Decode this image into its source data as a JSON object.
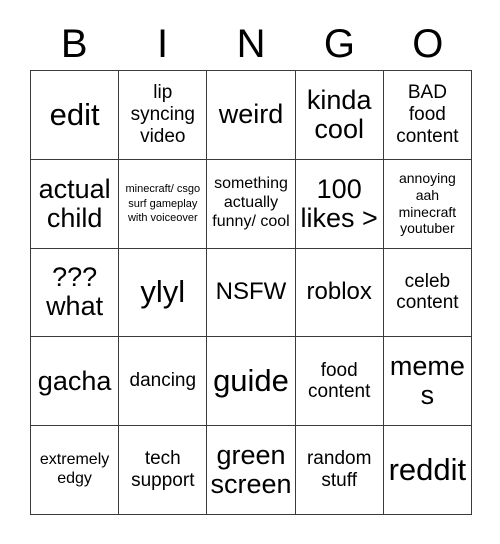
{
  "card": {
    "title": "BINGO",
    "header_letters": [
      "B",
      "I",
      "N",
      "G",
      "O"
    ],
    "columns": 5,
    "rows": 5,
    "border_color": "#3a3a3a",
    "background_color": "#ffffff",
    "text_color": "#000000",
    "cells": [
      {
        "text": "edit",
        "size": "xxl"
      },
      {
        "text": "lip syncing video",
        "size": "md"
      },
      {
        "text": "weird",
        "size": "xl"
      },
      {
        "text": "kinda cool",
        "size": "xl"
      },
      {
        "text": "BAD food content",
        "size": "md"
      },
      {
        "text": "actual child",
        "size": "xl"
      },
      {
        "text": "minecraft/ csgo surf gameplay with voiceover",
        "size": "xxs"
      },
      {
        "text": "something actually funny/ cool",
        "size": "sm"
      },
      {
        "text": "100 likes >",
        "size": "xl"
      },
      {
        "text": "annoying aah minecraft youtuber",
        "size": "xs"
      },
      {
        "text": "??? what",
        "size": "xl"
      },
      {
        "text": "ylyl",
        "size": "xxl"
      },
      {
        "text": "NSFW",
        "size": "lg"
      },
      {
        "text": "roblox",
        "size": "lg"
      },
      {
        "text": "celeb content",
        "size": "md"
      },
      {
        "text": "gacha",
        "size": "xl"
      },
      {
        "text": "dancing",
        "size": "md"
      },
      {
        "text": "guide",
        "size": "xxl"
      },
      {
        "text": "food content",
        "size": "md"
      },
      {
        "text": "memes",
        "size": "xl"
      },
      {
        "text": "extremely edgy",
        "size": "sm"
      },
      {
        "text": "tech support",
        "size": "md"
      },
      {
        "text": "green screen",
        "size": "xl"
      },
      {
        "text": "random stuff",
        "size": "md"
      },
      {
        "text": "reddit",
        "size": "xxl"
      }
    ]
  }
}
